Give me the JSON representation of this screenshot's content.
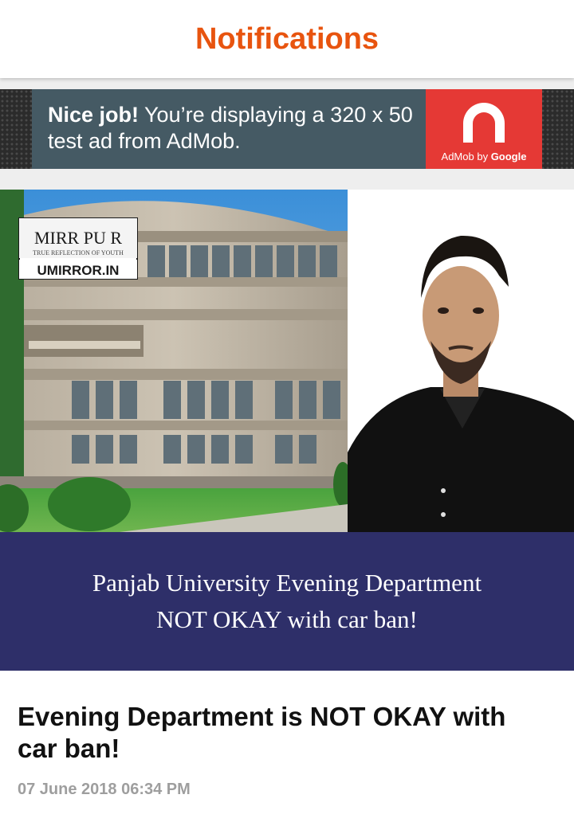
{
  "app_bar": {
    "title": "Notifications",
    "title_color": "#E8540F"
  },
  "ad": {
    "bold_text": "Nice job!",
    "body_text": " You’re displaying a 320 x 50 test ad from AdMob.",
    "caption_prefix": "AdMob by ",
    "caption_brand": "Google",
    "text_bg_color": "#455A64",
    "logo_bg_color": "#E53935"
  },
  "article": {
    "image": {
      "watermark_logo": "MIRR PU R",
      "watermark_tagline": "TRUE REFLECTION OF YOUTH",
      "watermark_site": "UMIRROR.IN",
      "caption_line1": "Panjab University Evening Department",
      "caption_line2": "NOT OKAY with car ban!",
      "caption_bg_color": "#2E2F69"
    },
    "title": "Evening Department is NOT OKAY with car ban!",
    "date": "07 June 2018 06:34 PM"
  }
}
